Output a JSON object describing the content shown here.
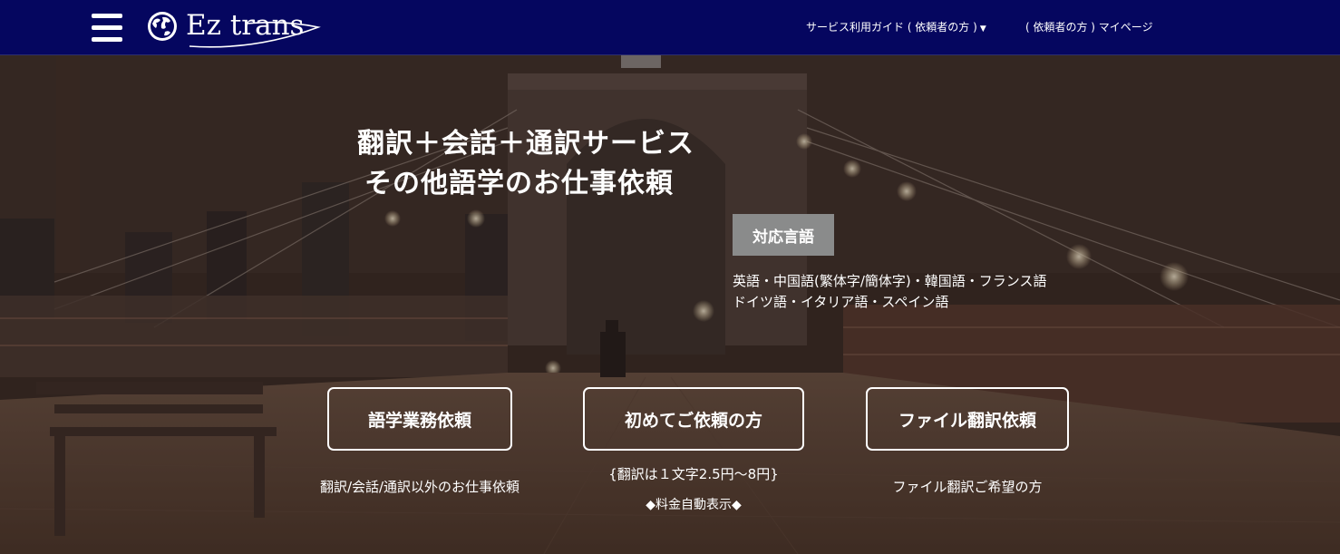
{
  "header": {
    "brand": "Ez trans",
    "nav_guide": "サービス利用ガイド ( 依頼者の方 )",
    "nav_mypage": "( 依頼者の方 ) マイページ"
  },
  "hero": {
    "heading_line1": "翻訳＋会話＋通訳サービス",
    "heading_line2": "その他語学のお仕事依頼",
    "languages_badge": "対応言語",
    "languages_line1": "英語・中国語(繁体字/簡体字)・韓国語・フランス語",
    "languages_line2": "ドイツ語・イタリア語・スペイン語"
  },
  "actions": {
    "language_work": {
      "label": "語学業務依頼",
      "caption": "翻訳/会話/通訳以外のお仕事依頼"
    },
    "first_time": {
      "label": "初めてご依頼の方",
      "caption": "{翻訳は１文字2.5円〜8円}",
      "caption2": "◆料金自動表示◆"
    },
    "file_translation": {
      "label": "ファイル翻訳依頼",
      "caption": "ファイル翻訳ご希望の方"
    }
  },
  "colors": {
    "navbar": "#05065f",
    "badge": "#8a8b8b",
    "text": "#ffffff"
  }
}
